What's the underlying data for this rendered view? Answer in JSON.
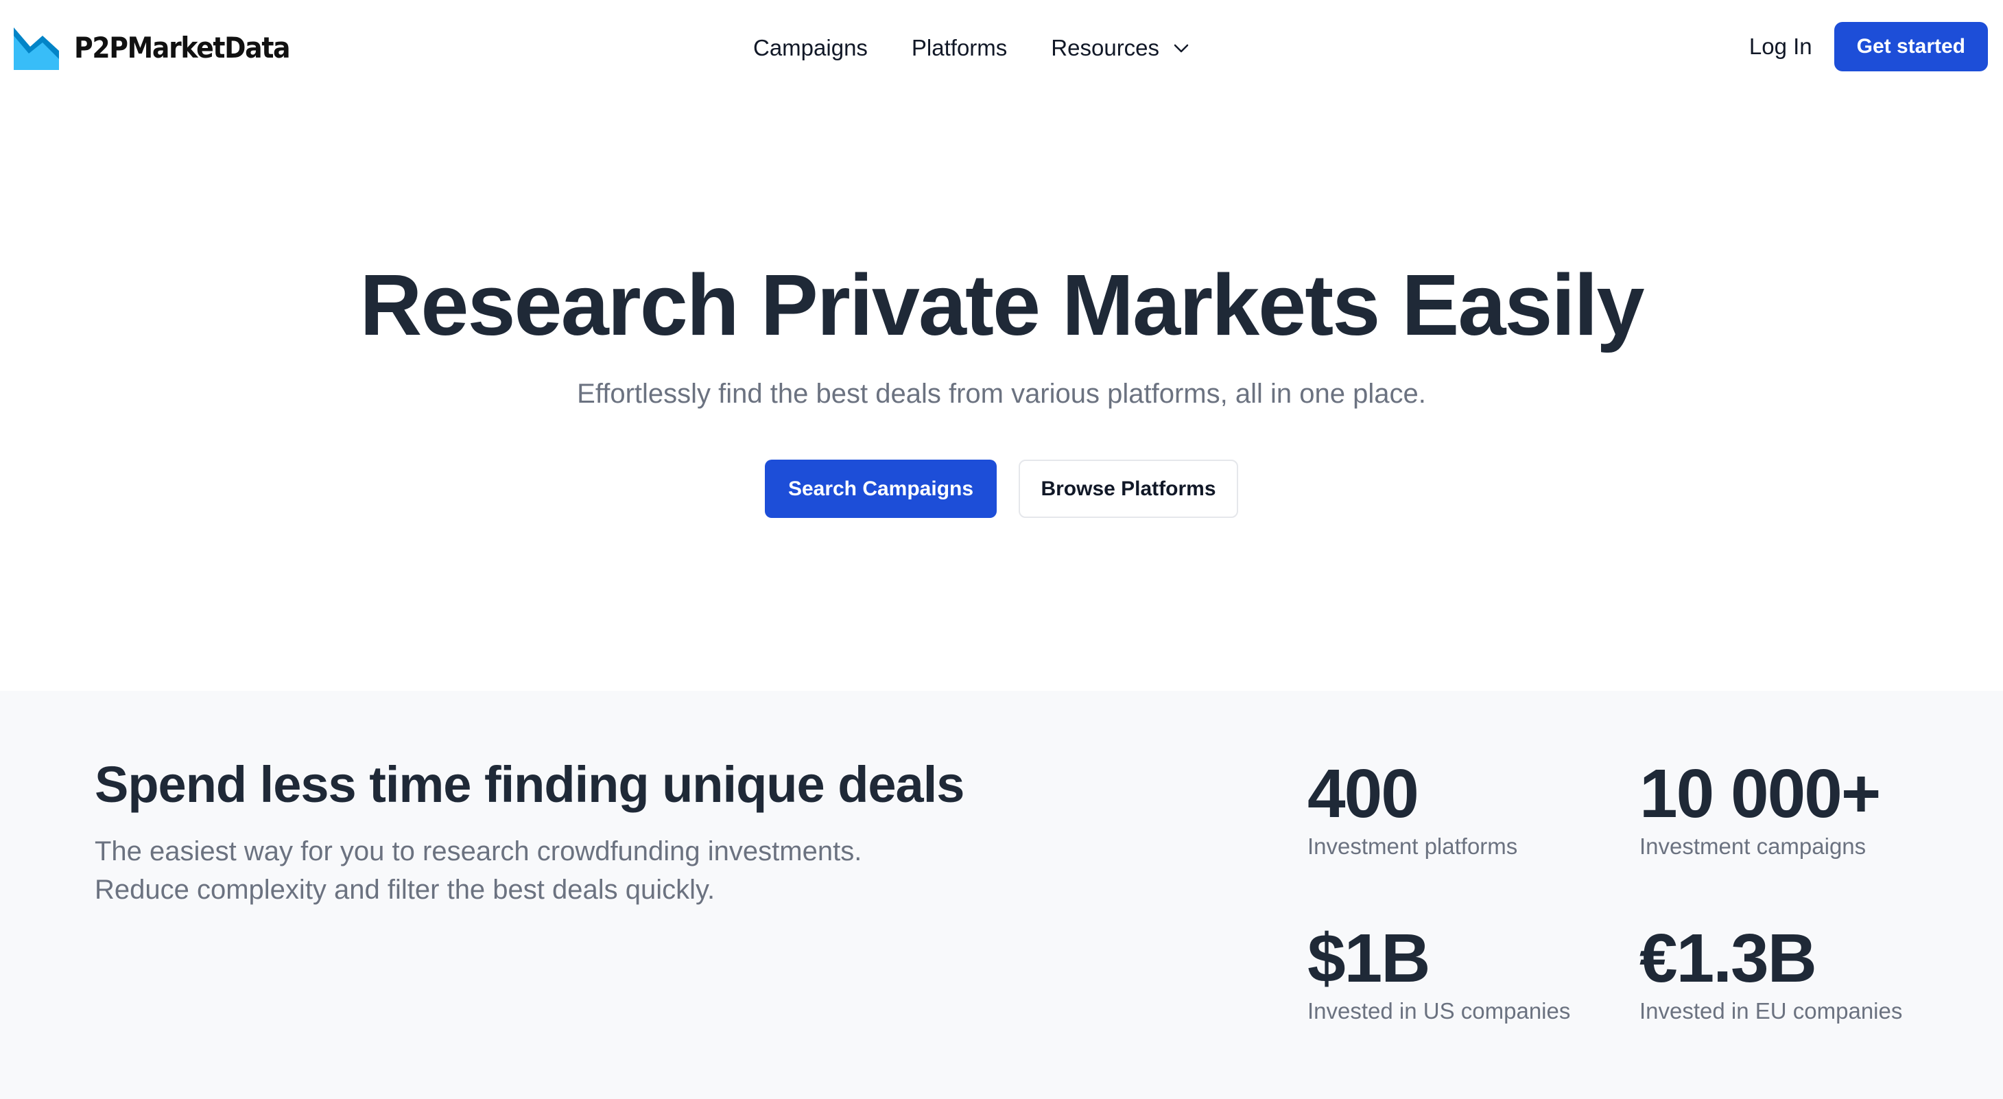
{
  "header": {
    "logo_text": "P2PMarketData",
    "logo_icon": "chart-zigzag-icon",
    "nav": {
      "campaigns": "Campaigns",
      "platforms": "Platforms",
      "resources": "Resources"
    },
    "login_label": "Log In",
    "get_started_label": "Get started"
  },
  "hero": {
    "title": "Research Private Markets Easily",
    "subtitle": "Effortlessly find the best deals from various platforms, all in one place.",
    "primary_cta": "Search Campaigns",
    "secondary_cta": "Browse Platforms"
  },
  "stats_section": {
    "heading": "Spend less time finding unique deals",
    "description_line1": "The easiest way for you to research crowdfunding investments.",
    "description_line2": "Reduce complexity and filter the best deals quickly.",
    "stats": [
      {
        "value": "400",
        "label": "Investment platforms"
      },
      {
        "value": "10 000+",
        "label": "Investment campaigns"
      },
      {
        "value": "$1B",
        "label": "Invested in US companies"
      },
      {
        "value": "€1.3B",
        "label": "Invested in EU companies"
      }
    ]
  },
  "colors": {
    "brand_blue": "#1d4ed8",
    "logo_light_blue": "#38bdf8",
    "logo_dark_blue": "#0284c7",
    "heading_text": "#1f2937",
    "muted_text": "#6b7280",
    "section_bg": "#f8f9fb"
  }
}
